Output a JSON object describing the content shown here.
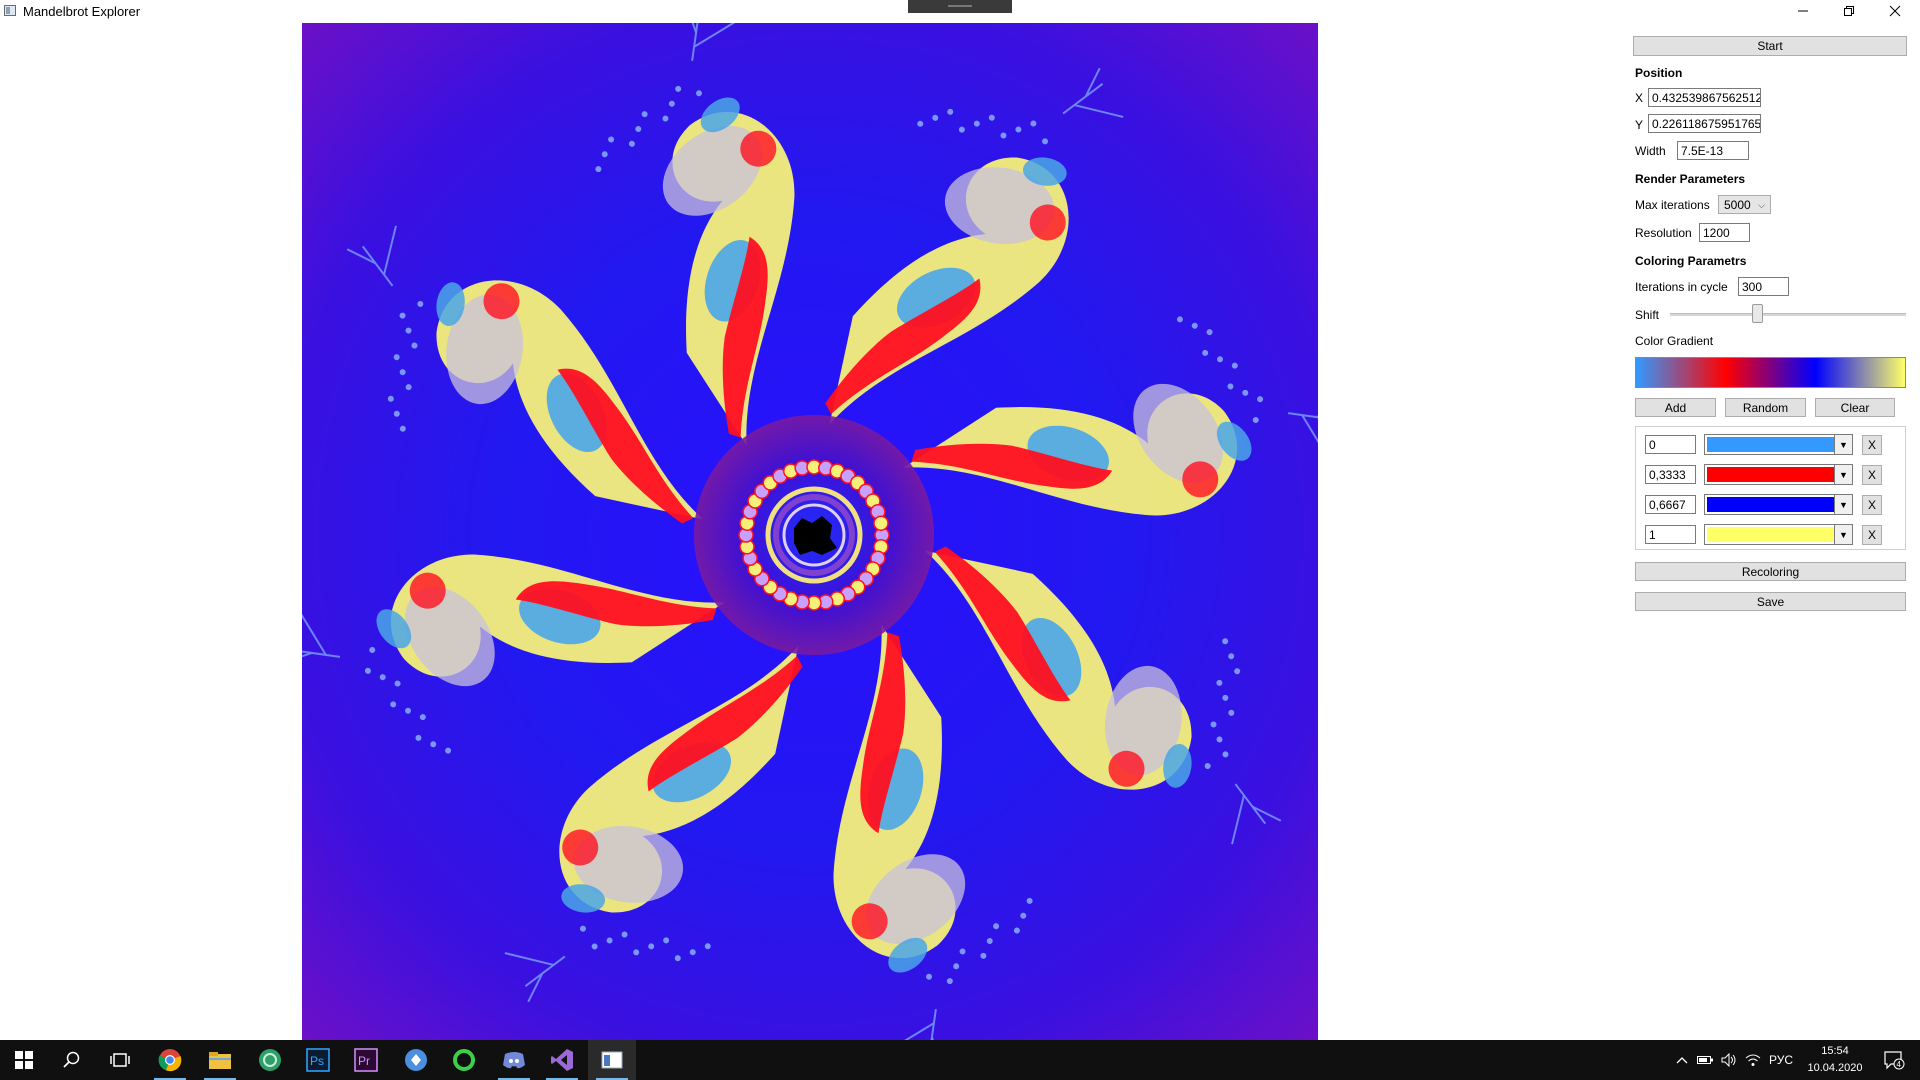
{
  "window": {
    "title": "Mandelbrot Explorer"
  },
  "panel": {
    "start_label": "Start",
    "position_header": "Position",
    "x_label": "X",
    "x_value": "0.432539867562512",
    "y_label": "Y",
    "y_value": "0.226118675951765",
    "width_label": "Width",
    "width_value": "7.5E-13",
    "render_header": "Render Parameters",
    "max_iter_label": "Max iterations",
    "max_iter_value": "5000",
    "resolution_label": "Resolution",
    "resolution_value": "1200",
    "coloring_header": "Coloring Parametrs",
    "iter_cycle_label": "Iterations in cycle",
    "iter_cycle_value": "300",
    "shift_label": "Shift",
    "shift_fraction": 0.37,
    "gradient_label": "Color Gradient",
    "add_label": "Add",
    "random_label": "Random",
    "clear_label": "Clear",
    "stops": [
      {
        "position": "0",
        "color": "#3399ff"
      },
      {
        "position": "0,3333",
        "color": "#ff0000"
      },
      {
        "position": "0,6667",
        "color": "#0000ff"
      },
      {
        "position": "1",
        "color": "#ffff66"
      }
    ],
    "remove_label": "X",
    "recolor_label": "Recoloring",
    "save_label": "Save"
  },
  "taskbar": {
    "apps": [
      "start-icon",
      "search-icon",
      "task-view-icon",
      "chrome-icon",
      "file-explorer-icon",
      "green-app-icon",
      "photoshop-icon",
      "premiere-icon",
      "blue-app-icon",
      "green-ring-app-icon",
      "discord-icon",
      "visual-studio-icon",
      "mandelbrot-explorer-icon"
    ],
    "ps_text": "Ps",
    "pr_text": "Pr",
    "language": "РУС",
    "time": "15:54",
    "date": "10.04.2020",
    "notification_count": "4"
  },
  "colors": {
    "fractal_bg": "#6a1ed1",
    "fractal_blue": "#1a1aff",
    "fractal_red": "#ff1020",
    "fractal_yellow": "#f5f07a",
    "fractal_lightblue": "#4aa6e8"
  }
}
